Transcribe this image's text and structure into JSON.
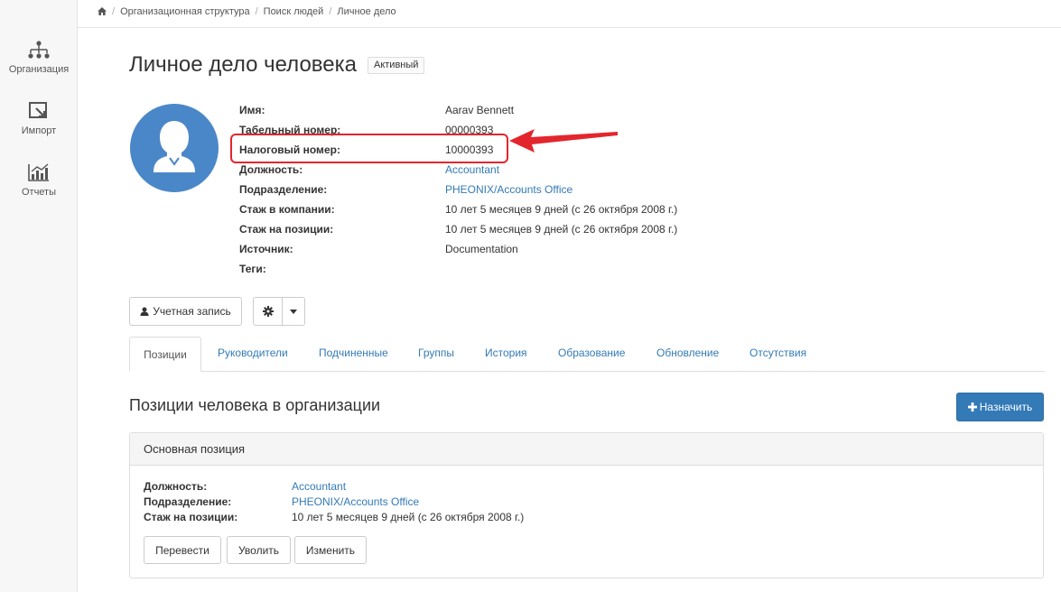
{
  "sidebar": {
    "items": [
      {
        "label": "Организация",
        "icon": "org-structure-icon"
      },
      {
        "label": "Импорт",
        "icon": "import-icon"
      },
      {
        "label": "Отчеты",
        "icon": "reports-icon"
      }
    ]
  },
  "breadcrumb": {
    "home_icon": "home-icon",
    "items": [
      "Организационная структура",
      "Поиск людей",
      "Личное дело"
    ]
  },
  "header": {
    "title": "Личное дело человека",
    "status": "Активный"
  },
  "profile": {
    "fields": [
      {
        "label": "Имя:",
        "value": "Aarav Bennett",
        "link": false
      },
      {
        "label": "Табельный номер:",
        "value": "00000393",
        "link": false
      },
      {
        "label": "Налоговый номер:",
        "value": "10000393",
        "link": false
      },
      {
        "label": "Должность:",
        "value": "Accountant",
        "link": true
      },
      {
        "label": "Подразделение:",
        "value": "PHEONIX/Accounts Office",
        "link": true
      },
      {
        "label": "Стаж в компании:",
        "value": "10 лет 5 месяцев 9 дней (с 26 октября 2008 г.)",
        "link": false
      },
      {
        "label": "Стаж на позиции:",
        "value": "10 лет 5 месяцев 9 дней (с 26 октября 2008 г.)",
        "link": false
      },
      {
        "label": "Источник:",
        "value": "Documentation",
        "link": false
      },
      {
        "label": "Теги:",
        "value": "",
        "link": false
      }
    ]
  },
  "actions": {
    "account_label": "Учетная запись"
  },
  "tabs": [
    {
      "label": "Позиции",
      "active": true
    },
    {
      "label": "Руководители",
      "active": false
    },
    {
      "label": "Подчиненные",
      "active": false
    },
    {
      "label": "Группы",
      "active": false
    },
    {
      "label": "История",
      "active": false
    },
    {
      "label": "Образование",
      "active": false
    },
    {
      "label": "Обновление",
      "active": false
    },
    {
      "label": "Отсутствия",
      "active": false
    }
  ],
  "positions": {
    "title": "Позиции человека в организации",
    "assign_label": "Назначить",
    "panel_title": "Основная позиция",
    "fields": [
      {
        "label": "Должность:",
        "value": "Accountant",
        "link": true
      },
      {
        "label": "Подразделение:",
        "value": "PHEONIX/Accounts Office",
        "link": true
      },
      {
        "label": "Стаж на позиции:",
        "value": "10 лет 5 месяцев 9 дней (с 26 октября 2008 г.)",
        "link": false
      }
    ],
    "buttons": {
      "transfer": "Перевести",
      "dismiss": "Уволить",
      "edit": "Изменить"
    }
  },
  "colors": {
    "accent": "#337ab7",
    "avatar_bg": "#4a87c8",
    "annotation": "#e3262d"
  }
}
